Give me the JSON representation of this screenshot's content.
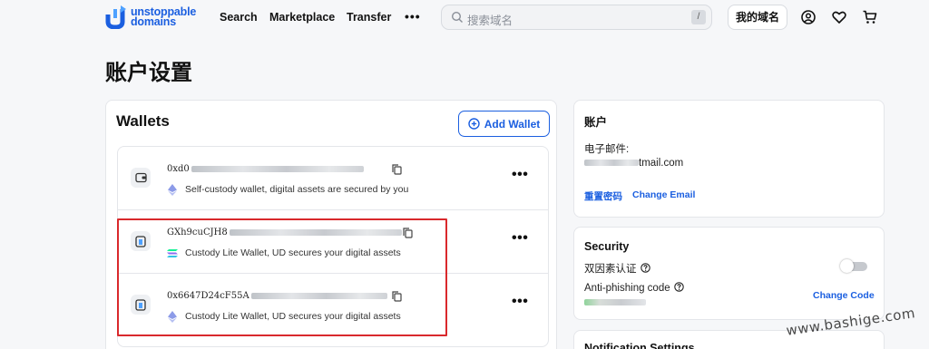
{
  "header": {
    "logo_line1": "unstoppable",
    "logo_line2": "domains",
    "nav": [
      "Search",
      "Marketplace",
      "Transfer"
    ],
    "more": "•••",
    "search_placeholder": "搜索域名",
    "search_shortcut": "/",
    "my_domains": "我的域名",
    "icons": [
      "user-circle-icon",
      "heart-icon",
      "cart-icon"
    ]
  },
  "page": {
    "title": "账户设置"
  },
  "wallets": {
    "title": "Wallets",
    "add_label": "Add Wallet",
    "items": [
      {
        "address_prefix": "0xd0",
        "chain_icon": "ethereum-icon",
        "desc": "Self-custody wallet, digital assets are secured by you"
      },
      {
        "address_prefix": "GXh9cuCJH8",
        "chain_icon": "solana-icon",
        "desc": "Custody Lite Wallet, UD secures your digital assets"
      },
      {
        "address_prefix": "0x6647D24cF55A",
        "chain_icon": "ethereum-icon",
        "desc": "Custody Lite Wallet, UD secures your digital assets"
      }
    ],
    "more": "•••"
  },
  "account": {
    "title": "账户",
    "email_label": "电子邮件:",
    "email_suffix": "tmail.com",
    "reset_password": "重置密码",
    "change_email": "Change Email"
  },
  "security": {
    "title": "Security",
    "two_factor_label": "双因素认证",
    "two_factor_enabled": false,
    "anti_phishing_label": "Anti-phishing code",
    "change_code": "Change Code"
  },
  "notifications": {
    "title": "Notification Settings"
  },
  "watermark": "www.bashige.com",
  "colors": {
    "brand": "#1b5fe0",
    "highlight": "#d9292c"
  }
}
